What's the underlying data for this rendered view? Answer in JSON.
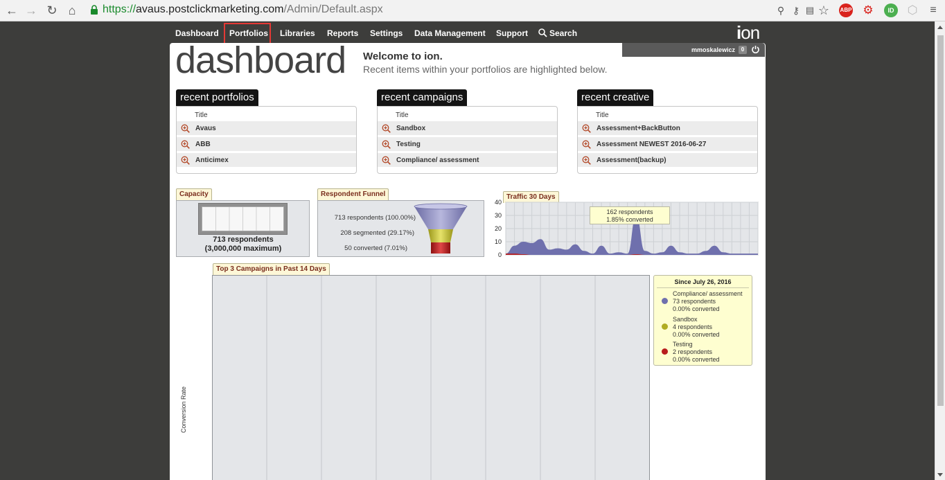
{
  "browser": {
    "url_protocol": "https://",
    "url_host": "avaus.postclickmarketing.com",
    "url_path": "/Admin/Default.aspx",
    "ext_abp": "ABP",
    "ext_id": "ID"
  },
  "nav": {
    "items": [
      "Dashboard",
      "Portfolios",
      "Libraries",
      "Reports",
      "Settings",
      "Data Management",
      "Support",
      "Search"
    ],
    "logo_i": "i",
    "logo_rest": "on"
  },
  "user": {
    "name": "mmoskalewicz",
    "count": "0"
  },
  "page": {
    "title": "dashboard",
    "welcome": "Welcome to ion.",
    "welcome_sub": "Recent items within your portfolios are highlighted below."
  },
  "recent": [
    {
      "tab": "recent portfolios",
      "col": "Title",
      "items": [
        "Avaus",
        "ABB",
        "Anticimex"
      ]
    },
    {
      "tab": "recent campaigns",
      "col": "Title",
      "items": [
        "Sandbox",
        "Testing",
        "Compliance/ assessment"
      ]
    },
    {
      "tab": "recent creative",
      "col": "Title",
      "items": [
        "Assessment+BackButton",
        "Assessment NEWEST 2016-06-27",
        "Assessment(backup)"
      ]
    }
  ],
  "capacity": {
    "tab": "Capacity",
    "line1": "713 respondents",
    "line2": "(3,000,000 maximum)"
  },
  "funnel": {
    "tab": "Respondent Funnel",
    "labels": [
      "713 respondents (100.00%)",
      "208 segmented (29.17%)",
      "50 converted (7.01%)"
    ],
    "colors": [
      "#8c8cbf",
      "#c4c031",
      "#b81c1c"
    ]
  },
  "traffic": {
    "tab": "Traffic 30 Days",
    "tooltip_line1": "162 respondents",
    "tooltip_line2": "1.85% converted"
  },
  "chart_data": {
    "type": "area",
    "title": "Traffic 30 Days",
    "xlabel": "",
    "ylabel": "",
    "ylim": [
      0,
      40
    ],
    "yticks": [
      0,
      10,
      20,
      30,
      40
    ],
    "grid": true,
    "series": [
      {
        "values": [
          1,
          7,
          10,
          9,
          12,
          4,
          5,
          4,
          8,
          3,
          1,
          7,
          1,
          2,
          1,
          30,
          3,
          1,
          2,
          7,
          2,
          1,
          1,
          3,
          7,
          2,
          1,
          1,
          1,
          1
        ],
        "color": "#6f70ad"
      },
      {
        "values": [
          1,
          1,
          0.5,
          0,
          0,
          0,
          0,
          0,
          0,
          0,
          0,
          0,
          0,
          0,
          0,
          0.5,
          0,
          0,
          0,
          0,
          0,
          0,
          0,
          0,
          0,
          0,
          0,
          0,
          0,
          0
        ],
        "color": "#b81c1c"
      }
    ]
  },
  "top3": {
    "tab": "Top 3 Campaigns in Past 14 Days",
    "ylabel": "Conversion Rate",
    "legend_title": "Since July 26, 2016",
    "legend": [
      {
        "name": "Compliance/ assessment",
        "resp": "73 respondents",
        "conv": "0.00% converted",
        "color": "#6f70ad"
      },
      {
        "name": "Sandbox",
        "resp": "4 respondents",
        "conv": "0.00% converted",
        "color": "#b0ac22"
      },
      {
        "name": "Testing",
        "resp": "2 respondents",
        "conv": "0.00% converted",
        "color": "#b81c1c"
      }
    ]
  }
}
